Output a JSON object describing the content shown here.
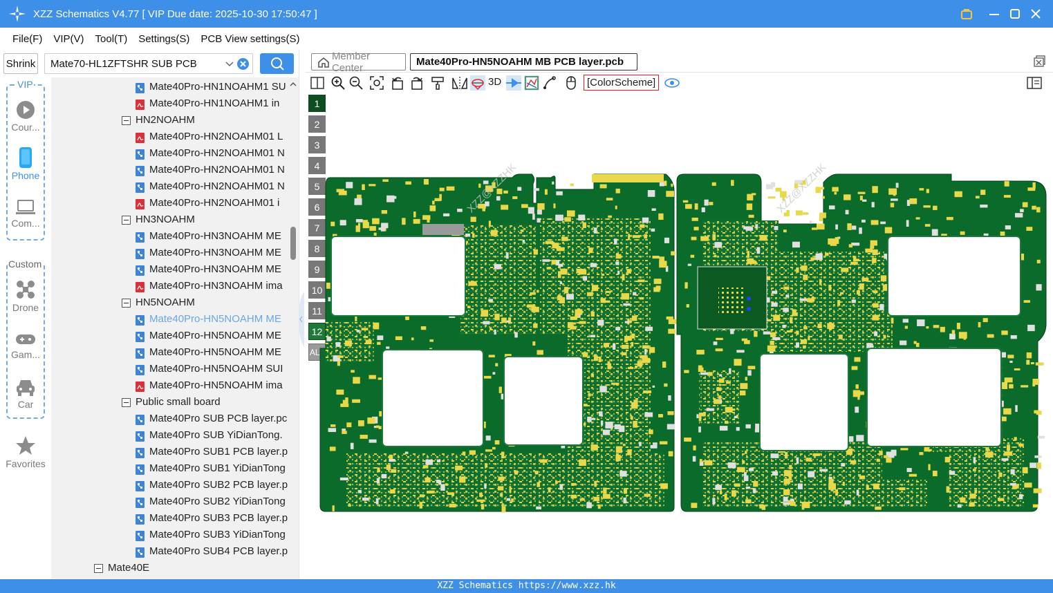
{
  "window": {
    "title": "XZZ Schematics V4.77 [ VIP Due date: 2025-10-30 17:50:47 ]"
  },
  "menu": [
    "File(F)",
    "VIP(V)",
    "Tool(T)",
    "Settings(S)",
    "PCB View settings(S)"
  ],
  "left_toolbar": {
    "shrink_label": "Shrink",
    "search_value": "Mate70-HL1ZFTSHR SUB PCB"
  },
  "rail": {
    "vip_label": "VIP",
    "custom_label": "Custom",
    "items": [
      "Cour...",
      "Phone",
      "Com...",
      "Drone",
      "Gam...",
      "Car",
      "Favorites"
    ],
    "active": "Phone"
  },
  "tree": {
    "rows": [
      {
        "level": 2,
        "icon": "pcb",
        "text": "Mate40Pro-HN1NOAHM1 SU"
      },
      {
        "level": 2,
        "icon": "pdf",
        "text": "Mate40Pro-HN1NOAHM1 in"
      },
      {
        "level": 1,
        "icon": "folder",
        "text": "HN2NOAHM"
      },
      {
        "level": 2,
        "icon": "pdf",
        "text": "Mate40Pro-HN2NOAHM01 L"
      },
      {
        "level": 2,
        "icon": "pcb",
        "text": "Mate40Pro-HN2NOAHM01 N"
      },
      {
        "level": 2,
        "icon": "pcb",
        "text": "Mate40Pro-HN2NOAHM01 N"
      },
      {
        "level": 2,
        "icon": "pcb",
        "text": "Mate40Pro-HN2NOAHM01 N"
      },
      {
        "level": 2,
        "icon": "pdf",
        "text": "Mate40Pro-HN2NOAHM01 i"
      },
      {
        "level": 1,
        "icon": "folder",
        "text": "HN3NOAHM"
      },
      {
        "level": 2,
        "icon": "pcb",
        "text": "Mate40Pro-HN3NOAHM ME"
      },
      {
        "level": 2,
        "icon": "pcb",
        "text": "Mate40Pro-HN3NOAHM ME"
      },
      {
        "level": 2,
        "icon": "pcb",
        "text": "Mate40Pro-HN3NOAHM ME"
      },
      {
        "level": 2,
        "icon": "pdf",
        "text": "Mate40Pro-HN3NOAHM ima"
      },
      {
        "level": 1,
        "icon": "folder",
        "text": "HN5NOAHM"
      },
      {
        "level": 2,
        "icon": "pcb",
        "text": "Mate40Pro-HN5NOAHM ME",
        "selected": true
      },
      {
        "level": 2,
        "icon": "pcb",
        "text": "Mate40Pro-HN5NOAHM ME"
      },
      {
        "level": 2,
        "icon": "pcb",
        "text": "Mate40Pro-HN5NOAHM ME"
      },
      {
        "level": 2,
        "icon": "pcb",
        "text": "Mate40Pro-HN5NOAHM SUI"
      },
      {
        "level": 2,
        "icon": "pdf",
        "text": "Mate40Pro-HN5NOAHM ima"
      },
      {
        "level": 1,
        "icon": "folder",
        "text": "Public small board"
      },
      {
        "level": 2,
        "icon": "pcb",
        "text": "Mate40Pro SUB PCB layer.pc"
      },
      {
        "level": 2,
        "icon": "pcb",
        "text": "Mate40Pro SUB YiDianTong."
      },
      {
        "level": 2,
        "icon": "pcb",
        "text": "Mate40Pro SUB1 PCB layer.p"
      },
      {
        "level": 2,
        "icon": "pcb",
        "text": "Mate40Pro SUB1 YiDianTong"
      },
      {
        "level": 2,
        "icon": "pcb",
        "text": "Mate40Pro SUB2 PCB layer.p"
      },
      {
        "level": 2,
        "icon": "pcb",
        "text": "Mate40Pro SUB2 YiDianTong"
      },
      {
        "level": 2,
        "icon": "pcb",
        "text": "Mate40Pro SUB3 PCB layer.p"
      },
      {
        "level": 2,
        "icon": "pcb",
        "text": "Mate40Pro SUB3 YiDianTong"
      },
      {
        "level": 2,
        "icon": "pcb",
        "text": "Mate40Pro SUB4 PCB layer.p"
      },
      {
        "level": 0,
        "icon": "folder",
        "text": "Mate40E"
      }
    ]
  },
  "tabs": {
    "home_label": "Member Center",
    "active_label": "Mate40Pro-HN5NOAHM MB PCB layer.pcb"
  },
  "pcb_toolbar": {
    "label_3d": "3D",
    "color_scheme_label": "[ColorScheme]"
  },
  "layers": [
    "1",
    "2",
    "3",
    "4",
    "5",
    "6",
    "7",
    "8",
    "9",
    "10",
    "11",
    "12",
    "ALL"
  ],
  "active_layers": [
    "1",
    "12"
  ],
  "watermark": "XZZ@XZZHK",
  "status_bar": "XZZ Schematics https://www.xzz.hk",
  "colors": {
    "accent": "#3d8fe8",
    "pcb_green": "#0b6b2a",
    "pad_yellow": "#e8d84a",
    "layer_active": "#1f7a3a"
  }
}
